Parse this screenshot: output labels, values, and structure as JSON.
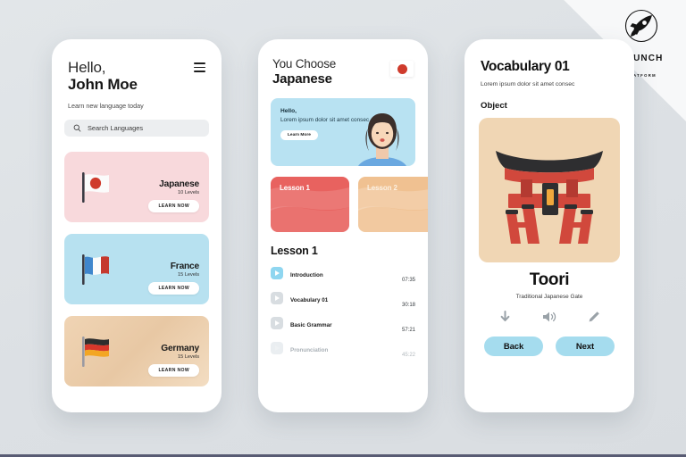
{
  "brand": {
    "name": "LAUNCH",
    "sub": "PLATFORM",
    "logo_icon": "rocket-icon"
  },
  "screen1": {
    "greeting_line1": "Hello,",
    "greeting_line2": "John Moe",
    "subtitle": "Learn new language today",
    "menu_icon": "hamburger-menu-icon",
    "search": {
      "icon": "search-icon",
      "placeholder": "Search Languages"
    },
    "languages": [
      {
        "name": "Japanese",
        "levels": "10 Levels",
        "cta": "LEARN NOW",
        "flag": "flag-japan"
      },
      {
        "name": "France",
        "levels": "15 Levels",
        "cta": "LEARN NOW",
        "flag": "flag-france"
      },
      {
        "name": "Germany",
        "levels": "15 Levels",
        "cta": "LEARN NOW",
        "flag": "flag-germany"
      }
    ]
  },
  "screen2": {
    "title_line1": "You Choose",
    "title_line2": "Japanese",
    "flag_badge_icon": "flag-japan-icon",
    "promo": {
      "heading": "Hello,",
      "body": "Lorem ipsum dolor sit amet consec",
      "cta": "Learn More",
      "illustration": "woman-avatar-illustration"
    },
    "lesson_cards": [
      {
        "label": "Lesson 1"
      },
      {
        "label": "Lesson 2"
      }
    ],
    "list_title": "Lesson 1",
    "tracks": [
      {
        "name": "Introduction",
        "time": "07:35",
        "progress": 70
      },
      {
        "name": "Vocabulary 01",
        "time": "30:18",
        "progress": 0
      },
      {
        "name": "Basic Grammar",
        "time": "57:21",
        "progress": 0
      },
      {
        "name": "Pronunciation",
        "time": "45:22",
        "progress": 0
      }
    ]
  },
  "screen3": {
    "title": "Vocabulary 01",
    "subtitle": "Lorem ipsum dolor sit amet consec",
    "section_label": "Object",
    "object_illustration": "torii-gate-illustration",
    "word": "Toori",
    "word_meaning": "Traditional Japanese Gate",
    "tools": [
      {
        "icon": "download-icon"
      },
      {
        "icon": "speaker-icon"
      },
      {
        "icon": "pencil-icon"
      }
    ],
    "back_label": "Back",
    "next_label": "Next"
  },
  "colors": {
    "background": "#dfe3e6",
    "accent_blue": "#a5dcee",
    "accent_red": "#cf3b2c",
    "card_pink": "#f8d9dc",
    "card_blue": "#b7e1f0",
    "card_tan": "#f0d6b4"
  }
}
